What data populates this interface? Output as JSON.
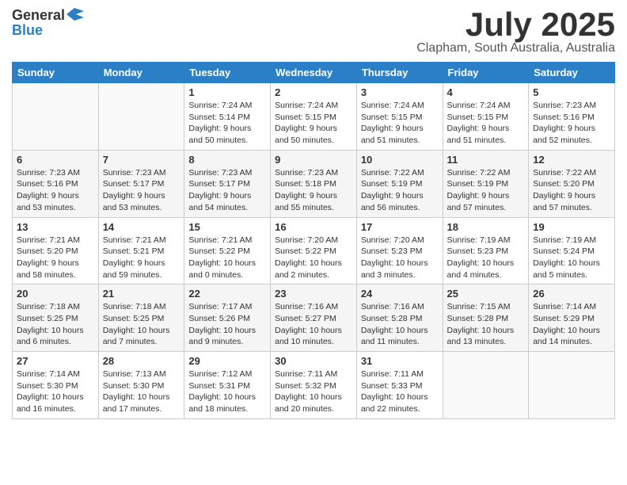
{
  "header": {
    "logo_line1": "General",
    "logo_line2": "Blue",
    "month": "July 2025",
    "location": "Clapham, South Australia, Australia"
  },
  "weekdays": [
    "Sunday",
    "Monday",
    "Tuesday",
    "Wednesday",
    "Thursday",
    "Friday",
    "Saturday"
  ],
  "weeks": [
    [
      {
        "day": "",
        "info": ""
      },
      {
        "day": "",
        "info": ""
      },
      {
        "day": "1",
        "info": "Sunrise: 7:24 AM\nSunset: 5:14 PM\nDaylight: 9 hours and 50 minutes."
      },
      {
        "day": "2",
        "info": "Sunrise: 7:24 AM\nSunset: 5:15 PM\nDaylight: 9 hours and 50 minutes."
      },
      {
        "day": "3",
        "info": "Sunrise: 7:24 AM\nSunset: 5:15 PM\nDaylight: 9 hours and 51 minutes."
      },
      {
        "day": "4",
        "info": "Sunrise: 7:24 AM\nSunset: 5:15 PM\nDaylight: 9 hours and 51 minutes."
      },
      {
        "day": "5",
        "info": "Sunrise: 7:23 AM\nSunset: 5:16 PM\nDaylight: 9 hours and 52 minutes."
      }
    ],
    [
      {
        "day": "6",
        "info": "Sunrise: 7:23 AM\nSunset: 5:16 PM\nDaylight: 9 hours and 53 minutes."
      },
      {
        "day": "7",
        "info": "Sunrise: 7:23 AM\nSunset: 5:17 PM\nDaylight: 9 hours and 53 minutes."
      },
      {
        "day": "8",
        "info": "Sunrise: 7:23 AM\nSunset: 5:17 PM\nDaylight: 9 hours and 54 minutes."
      },
      {
        "day": "9",
        "info": "Sunrise: 7:23 AM\nSunset: 5:18 PM\nDaylight: 9 hours and 55 minutes."
      },
      {
        "day": "10",
        "info": "Sunrise: 7:22 AM\nSunset: 5:19 PM\nDaylight: 9 hours and 56 minutes."
      },
      {
        "day": "11",
        "info": "Sunrise: 7:22 AM\nSunset: 5:19 PM\nDaylight: 9 hours and 57 minutes."
      },
      {
        "day": "12",
        "info": "Sunrise: 7:22 AM\nSunset: 5:20 PM\nDaylight: 9 hours and 57 minutes."
      }
    ],
    [
      {
        "day": "13",
        "info": "Sunrise: 7:21 AM\nSunset: 5:20 PM\nDaylight: 9 hours and 58 minutes."
      },
      {
        "day": "14",
        "info": "Sunrise: 7:21 AM\nSunset: 5:21 PM\nDaylight: 9 hours and 59 minutes."
      },
      {
        "day": "15",
        "info": "Sunrise: 7:21 AM\nSunset: 5:22 PM\nDaylight: 10 hours and 0 minutes."
      },
      {
        "day": "16",
        "info": "Sunrise: 7:20 AM\nSunset: 5:22 PM\nDaylight: 10 hours and 2 minutes."
      },
      {
        "day": "17",
        "info": "Sunrise: 7:20 AM\nSunset: 5:23 PM\nDaylight: 10 hours and 3 minutes."
      },
      {
        "day": "18",
        "info": "Sunrise: 7:19 AM\nSunset: 5:23 PM\nDaylight: 10 hours and 4 minutes."
      },
      {
        "day": "19",
        "info": "Sunrise: 7:19 AM\nSunset: 5:24 PM\nDaylight: 10 hours and 5 minutes."
      }
    ],
    [
      {
        "day": "20",
        "info": "Sunrise: 7:18 AM\nSunset: 5:25 PM\nDaylight: 10 hours and 6 minutes."
      },
      {
        "day": "21",
        "info": "Sunrise: 7:18 AM\nSunset: 5:25 PM\nDaylight: 10 hours and 7 minutes."
      },
      {
        "day": "22",
        "info": "Sunrise: 7:17 AM\nSunset: 5:26 PM\nDaylight: 10 hours and 9 minutes."
      },
      {
        "day": "23",
        "info": "Sunrise: 7:16 AM\nSunset: 5:27 PM\nDaylight: 10 hours and 10 minutes."
      },
      {
        "day": "24",
        "info": "Sunrise: 7:16 AM\nSunset: 5:28 PM\nDaylight: 10 hours and 11 minutes."
      },
      {
        "day": "25",
        "info": "Sunrise: 7:15 AM\nSunset: 5:28 PM\nDaylight: 10 hours and 13 minutes."
      },
      {
        "day": "26",
        "info": "Sunrise: 7:14 AM\nSunset: 5:29 PM\nDaylight: 10 hours and 14 minutes."
      }
    ],
    [
      {
        "day": "27",
        "info": "Sunrise: 7:14 AM\nSunset: 5:30 PM\nDaylight: 10 hours and 16 minutes."
      },
      {
        "day": "28",
        "info": "Sunrise: 7:13 AM\nSunset: 5:30 PM\nDaylight: 10 hours and 17 minutes."
      },
      {
        "day": "29",
        "info": "Sunrise: 7:12 AM\nSunset: 5:31 PM\nDaylight: 10 hours and 18 minutes."
      },
      {
        "day": "30",
        "info": "Sunrise: 7:11 AM\nSunset: 5:32 PM\nDaylight: 10 hours and 20 minutes."
      },
      {
        "day": "31",
        "info": "Sunrise: 7:11 AM\nSunset: 5:33 PM\nDaylight: 10 hours and 22 minutes."
      },
      {
        "day": "",
        "info": ""
      },
      {
        "day": "",
        "info": ""
      }
    ]
  ]
}
